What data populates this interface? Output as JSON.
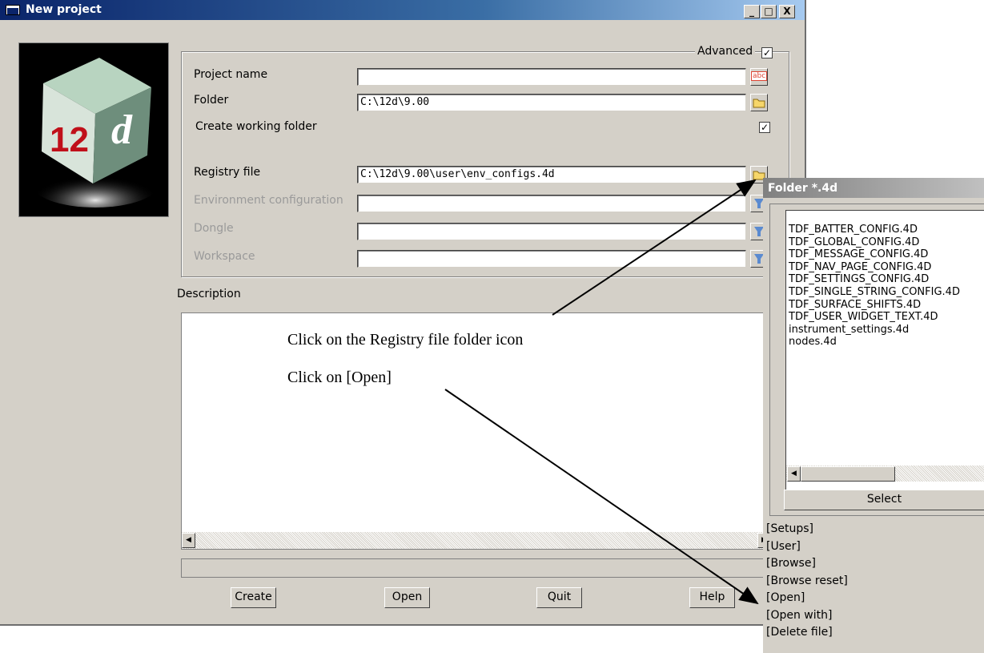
{
  "window": {
    "title": "New project",
    "min_label": "_",
    "max_label": "□",
    "close_label": "X"
  },
  "logo": {
    "text_12": "12",
    "text_d": "d"
  },
  "form": {
    "advanced_label": "Advanced",
    "advanced_checked": "✓",
    "project_name_label": "Project name",
    "project_name_value": "",
    "folder_label": "Folder",
    "folder_value": "C:\\12d\\9.00",
    "working_folder_label": "Create working folder",
    "working_folder_checked": "✓",
    "registry_label": "Registry file",
    "registry_value": "C:\\12d\\9.00\\user\\env_configs.4d",
    "env_config_label": "Environment configuration",
    "env_config_value": "",
    "dongle_label": "Dongle",
    "dongle_value": "",
    "workspace_label": "Workspace",
    "workspace_value": "",
    "abc_icon_text": "abc"
  },
  "description": {
    "label": "Description",
    "value": ""
  },
  "buttons": {
    "create": "Create",
    "open": "Open",
    "quit": "Quit",
    "help": "Help"
  },
  "annotations": {
    "line1": "Click on the Registry file folder icon",
    "line2": "Click on [Open]"
  },
  "popup": {
    "title": "Folder *.4d",
    "files": [
      "TDF_BATTER_CONFIG.4D",
      "TDF_GLOBAL_CONFIG.4D",
      "TDF_MESSAGE_CONFIG.4D",
      "TDF_NAV_PAGE_CONFIG.4D",
      "TDF_SETTINGS_CONFIG.4D",
      "TDF_SINGLE_STRING_CONFIG.4D",
      "TDF_SURFACE_SHIFTS.4D",
      "TDF_USER_WIDGET_TEXT.4D",
      "instrument_settings.4d",
      "nodes.4d"
    ],
    "select_label": "Select",
    "menu": [
      "[Setups]",
      "[User]",
      "[Browse]",
      "[Browse reset]",
      "[Open]",
      "[Open with]",
      "[Delete file]"
    ]
  }
}
